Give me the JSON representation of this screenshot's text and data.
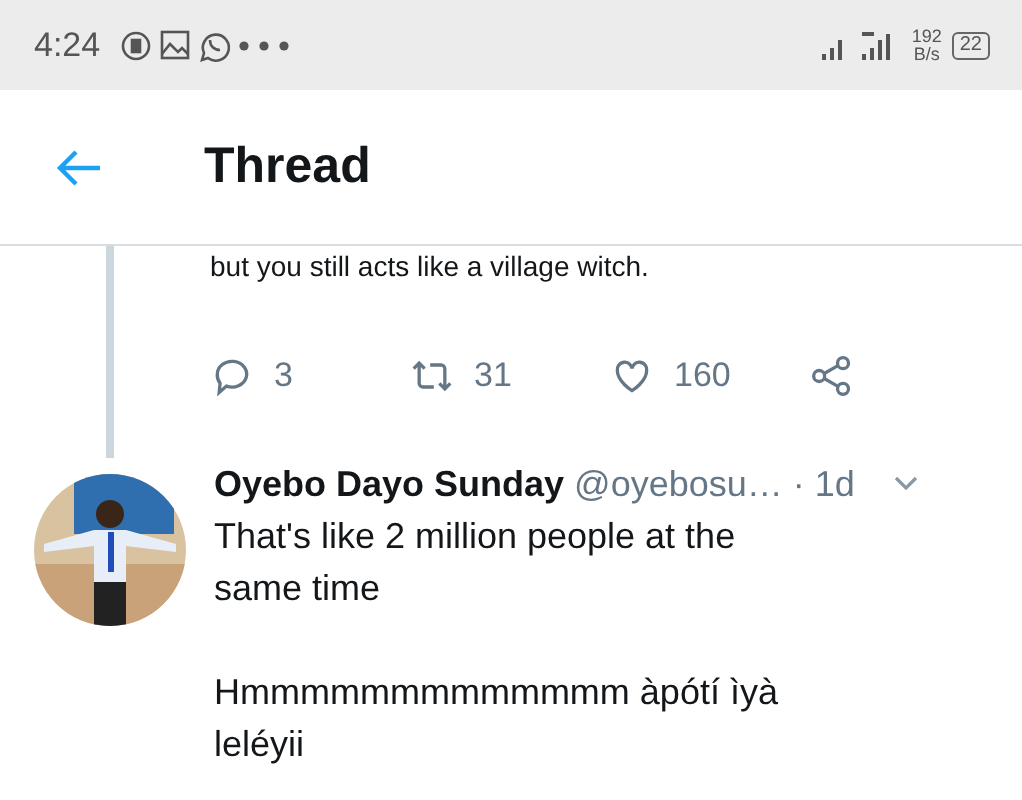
{
  "status_bar": {
    "time": "4:24",
    "speed_value": "192",
    "speed_unit": "B/s",
    "battery": "22"
  },
  "header": {
    "title": "Thread"
  },
  "previous_tweet": {
    "text_tail": "but you still acts like a village witch.",
    "replies": "3",
    "retweets": "31",
    "likes": "160"
  },
  "tweet": {
    "name": "Oyebo Dayo Sunday",
    "handle": "@oyebosu…",
    "time": "· 1d",
    "lines": [
      "That's like 2 million people at the same time",
      "Hmmmmmmmmmmmmm àpótí ìyà leléyii"
    ]
  }
}
